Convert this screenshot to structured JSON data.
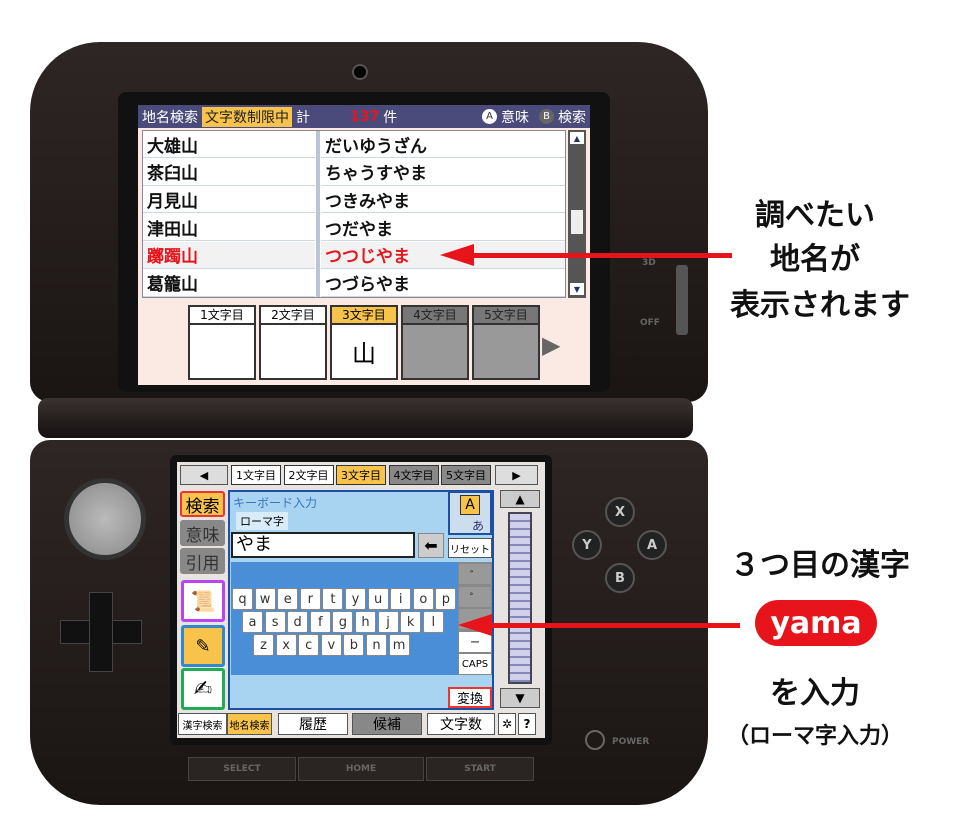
{
  "top_screen": {
    "header": {
      "mode": "地名検索",
      "badge": "文字数制限中",
      "total_label": "計",
      "count": "137",
      "count_unit": "件",
      "a_label": "意味",
      "b_label": "検索",
      "a_icon": "A",
      "b_icon": "B"
    },
    "rows": [
      {
        "kanji": "大雄山",
        "reading": "だいゆうざん",
        "selected": false
      },
      {
        "kanji": "茶臼山",
        "reading": "ちゃうすやま",
        "selected": false
      },
      {
        "kanji": "月見山",
        "reading": "つきみやま",
        "selected": false
      },
      {
        "kanji": "津田山",
        "reading": "つだやま",
        "selected": false
      },
      {
        "kanji": "躑躅山",
        "reading": "つつじやま",
        "selected": true
      },
      {
        "kanji": "葛籠山",
        "reading": "つづらやま",
        "selected": false
      }
    ],
    "char_slots": [
      {
        "label": "1文字目",
        "value": ""
      },
      {
        "label": "2文字目",
        "value": ""
      },
      {
        "label": "3文字目",
        "value": "山"
      },
      {
        "label": "4文字目",
        "value": ""
      },
      {
        "label": "5文字目",
        "value": ""
      }
    ]
  },
  "bottom_screen": {
    "tabs": [
      "1文字目",
      "2文字目",
      "3文字目",
      "4文字目",
      "5文字目"
    ],
    "active_tab": "3文字目",
    "side": [
      "検索",
      "意味",
      "引用"
    ],
    "panel_title": "キーボード入力",
    "mode_label": "ローマ字",
    "input_value": "やま",
    "reset": "リセット",
    "toggle_icon_a": "A",
    "toggle_icon_b": "あ",
    "keys_row1": [
      "q",
      "w",
      "e",
      "r",
      "t",
      "y",
      "u",
      "i",
      "o",
      "p"
    ],
    "keys_row2": [
      "a",
      "s",
      "d",
      "f",
      "g",
      "h",
      "j",
      "k",
      "l"
    ],
    "keys_row3": [
      "z",
      "x",
      "c",
      "v",
      "b",
      "n",
      "m"
    ],
    "side_keys": [
      "゛",
      "゜",
      "、",
      "ー",
      "CAPS"
    ],
    "convert": "変換",
    "bottom_bar": [
      "漢字検索",
      "地名検索",
      "履歴",
      "候補",
      "文字数"
    ],
    "help": "?"
  },
  "device": {
    "buttons": [
      "X",
      "Y",
      "A",
      "B"
    ],
    "select": "SELECT",
    "home": "HOME",
    "start": "START",
    "power": "POWER",
    "slider_3d": "3D",
    "slider_off": "OFF"
  },
  "annotations": {
    "top": [
      "調べたい",
      "地名が",
      "表示されます"
    ],
    "bottom_line1": "３つ目の漢字",
    "bottom_pill": "yama",
    "bottom_line2": "を入力",
    "bottom_line3": "（ローマ字入力）"
  },
  "colors": {
    "accent_red": "#e8141c",
    "tab_active": "#f7c34a",
    "header": "#4a4b7a",
    "panel": "#a8d4f2"
  }
}
